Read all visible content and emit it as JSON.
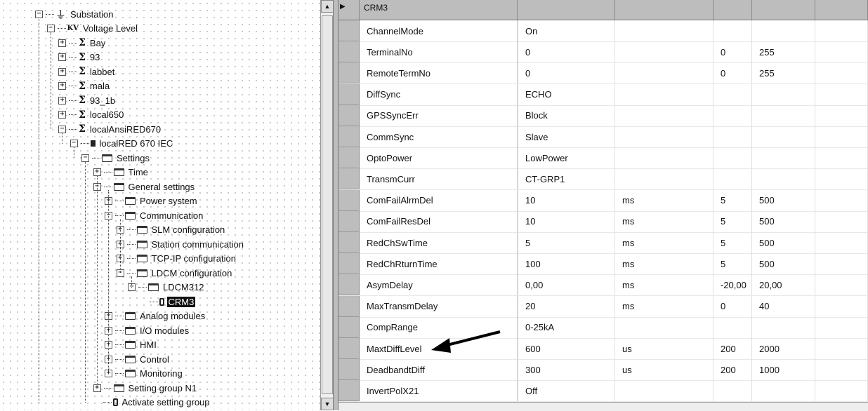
{
  "tree": {
    "items": [
      {
        "label": "Substation",
        "indent": 0,
        "icon": "substation-icon",
        "exp": "minus"
      },
      {
        "label": "Voltage Level",
        "indent": 1,
        "icon": "voltage-level-icon",
        "exp": "minus"
      },
      {
        "label": "Bay",
        "indent": 2,
        "icon": "bay-icon",
        "exp": "plus"
      },
      {
        "label": "93",
        "indent": 2,
        "icon": "bay-icon",
        "exp": "plus"
      },
      {
        "label": "labbet",
        "indent": 2,
        "icon": "bay-icon",
        "exp": "plus"
      },
      {
        "label": "mala",
        "indent": 2,
        "icon": "bay-icon",
        "exp": "plus"
      },
      {
        "label": "93_1b",
        "indent": 2,
        "icon": "bay-icon",
        "exp": "plus"
      },
      {
        "label": "local650",
        "indent": 2,
        "icon": "bay-icon",
        "exp": "plus"
      },
      {
        "label": "localAnsiRED670",
        "indent": 2,
        "icon": "bay-icon",
        "exp": "minus"
      },
      {
        "label": "localRED 670 IEC",
        "indent": 3,
        "icon": "ied-icon",
        "exp": "minus"
      },
      {
        "label": "Settings",
        "indent": 4,
        "icon": "folder-icon",
        "exp": "minus"
      },
      {
        "label": "Time",
        "indent": 5,
        "icon": "folder-icon",
        "exp": "plus"
      },
      {
        "label": "General settings",
        "indent": 5,
        "icon": "folder-icon",
        "exp": "minus"
      },
      {
        "label": "Power system",
        "indent": 6,
        "icon": "folder-icon",
        "exp": "plus"
      },
      {
        "label": "Communication",
        "indent": 6,
        "icon": "folder-icon",
        "exp": "minus"
      },
      {
        "label": "SLM configuration",
        "indent": 7,
        "icon": "folder-icon",
        "exp": "plus"
      },
      {
        "label": "Station communication",
        "indent": 7,
        "icon": "folder-icon",
        "exp": "plus"
      },
      {
        "label": "TCP-IP configuration",
        "indent": 7,
        "icon": "folder-icon",
        "exp": "plus"
      },
      {
        "label": "LDCM configuration",
        "indent": 7,
        "icon": "folder-icon",
        "exp": "minus"
      },
      {
        "label": "LDCM312",
        "indent": 8,
        "icon": "folder-icon",
        "exp": "minus"
      },
      {
        "label": "CRM3",
        "indent": 9,
        "icon": "leaf-icon",
        "exp": "none",
        "selected": true
      },
      {
        "label": "Analog modules",
        "indent": 6,
        "icon": "folder-icon",
        "exp": "plus"
      },
      {
        "label": "I/O modules",
        "indent": 6,
        "icon": "folder-icon",
        "exp": "plus"
      },
      {
        "label": "HMI",
        "indent": 6,
        "icon": "folder-icon",
        "exp": "plus"
      },
      {
        "label": "Control",
        "indent": 6,
        "icon": "folder-icon",
        "exp": "plus"
      },
      {
        "label": "Monitoring",
        "indent": 6,
        "icon": "folder-icon",
        "exp": "plus"
      },
      {
        "label": "Setting group N1",
        "indent": 5,
        "icon": "folder-icon",
        "exp": "plus"
      },
      {
        "label": "Activate setting group",
        "indent": 5,
        "icon": "leaf-icon",
        "exp": "none"
      }
    ]
  },
  "grid": {
    "header": "CRM3",
    "rows": [
      {
        "name": "ChannelMode",
        "value": "On",
        "unit": "",
        "min": "",
        "max": ""
      },
      {
        "name": "TerminalNo",
        "value": "0",
        "unit": "",
        "min": "0",
        "max": "255"
      },
      {
        "name": "RemoteTermNo",
        "value": "0",
        "unit": "",
        "min": "0",
        "max": "255"
      },
      {
        "name": "DiffSync",
        "value": "ECHO",
        "unit": "",
        "min": "",
        "max": ""
      },
      {
        "name": "GPSSyncErr",
        "value": "Block",
        "unit": "",
        "min": "",
        "max": ""
      },
      {
        "name": "CommSync",
        "value": "Slave",
        "unit": "",
        "min": "",
        "max": ""
      },
      {
        "name": "OptoPower",
        "value": "LowPower",
        "unit": "",
        "min": "",
        "max": ""
      },
      {
        "name": "TransmCurr",
        "value": "CT-GRP1",
        "unit": "",
        "min": "",
        "max": ""
      },
      {
        "name": "ComFailAlrmDel",
        "value": "10",
        "unit": "ms",
        "min": "5",
        "max": "500"
      },
      {
        "name": "ComFailResDel",
        "value": "10",
        "unit": "ms",
        "min": "5",
        "max": "500"
      },
      {
        "name": "RedChSwTime",
        "value": "5",
        "unit": "ms",
        "min": "5",
        "max": "500"
      },
      {
        "name": "RedChRturnTime",
        "value": "100",
        "unit": "ms",
        "min": "5",
        "max": "500"
      },
      {
        "name": "AsymDelay",
        "value": "0,00",
        "unit": "ms",
        "min": "-20,00",
        "max": "20,00"
      },
      {
        "name": "MaxTransmDelay",
        "value": "20",
        "unit": "ms",
        "min": "0",
        "max": "40"
      },
      {
        "name": "CompRange",
        "value": "0-25kA",
        "unit": "",
        "min": "",
        "max": ""
      },
      {
        "name": "MaxtDiffLevel",
        "value": "600",
        "unit": "us",
        "min": "200",
        "max": "2000"
      },
      {
        "name": "DeadbandtDiff",
        "value": "300",
        "unit": "us",
        "min": "200",
        "max": "1000"
      },
      {
        "name": "InvertPolX21",
        "value": "Off",
        "unit": "",
        "min": "",
        "max": ""
      }
    ]
  },
  "annotation": {
    "arrow_points_to": "MaxtDiffLevel"
  }
}
